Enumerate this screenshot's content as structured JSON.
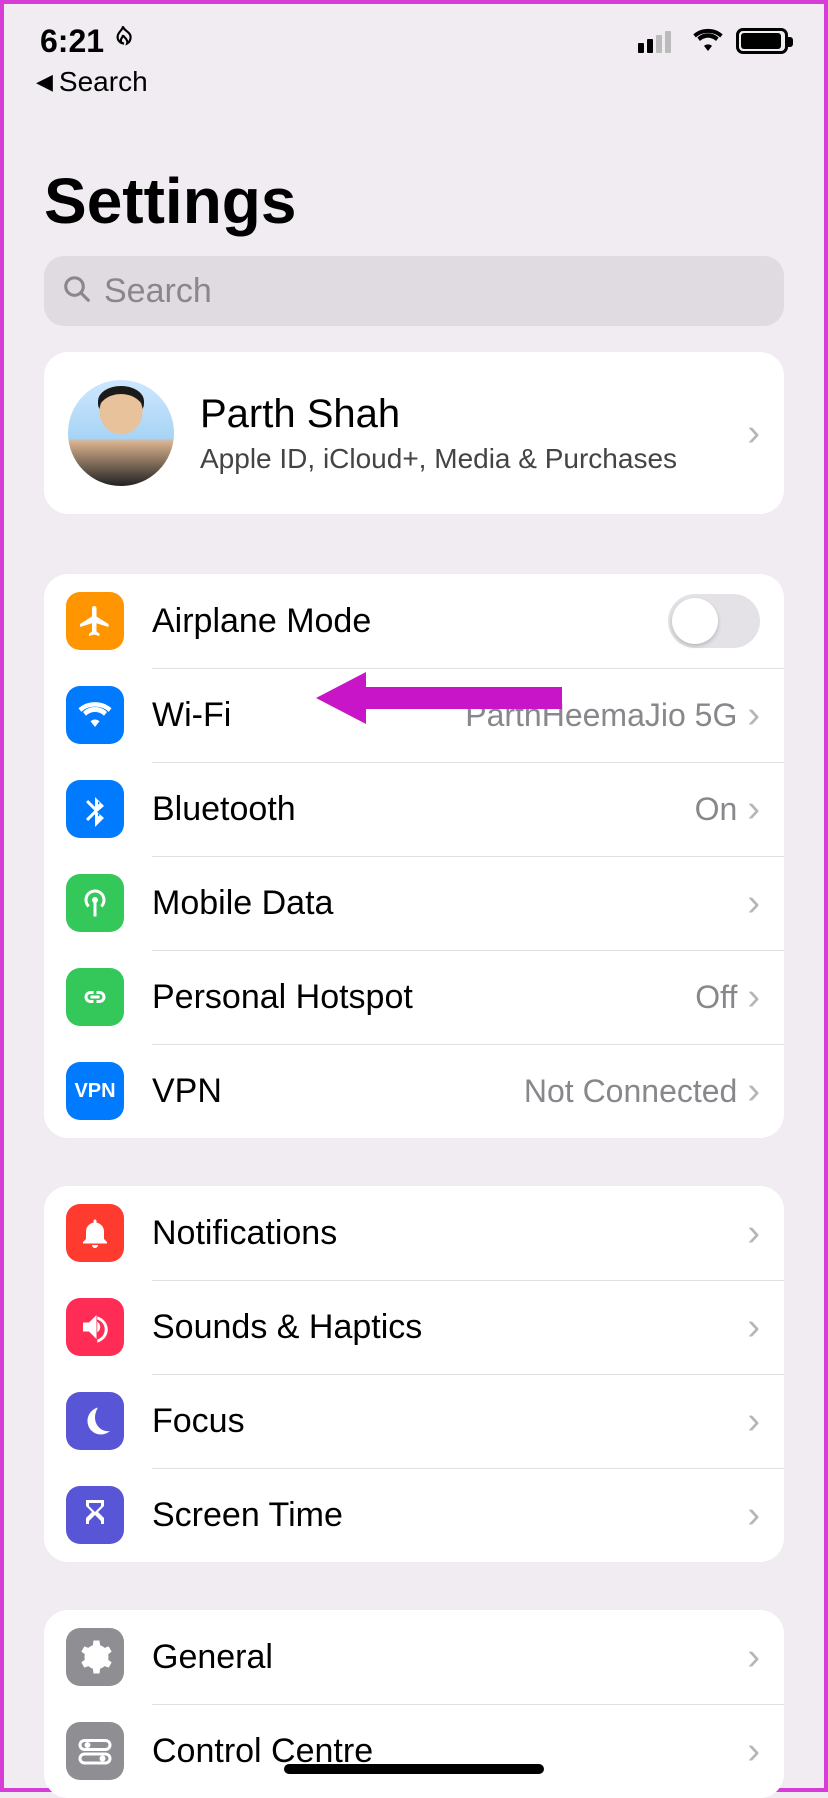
{
  "status": {
    "time": "6:21"
  },
  "back": {
    "label": "Search"
  },
  "title": "Settings",
  "search": {
    "placeholder": "Search"
  },
  "profile": {
    "name": "Parth Shah",
    "subtitle": "Apple ID, iCloud+, Media & Purchases"
  },
  "network": {
    "airplane": "Airplane Mode",
    "wifi": {
      "label": "Wi-Fi",
      "value": "ParthHeemaJio 5G"
    },
    "bluetooth": {
      "label": "Bluetooth",
      "value": "On"
    },
    "mobile": "Mobile Data",
    "hotspot": {
      "label": "Personal Hotspot",
      "value": "Off"
    },
    "vpn": {
      "label": "VPN",
      "value": "Not Connected"
    }
  },
  "prefs": {
    "notifications": "Notifications",
    "sounds": "Sounds & Haptics",
    "focus": "Focus",
    "screentime": "Screen Time"
  },
  "system": {
    "general": "General",
    "control": "Control Centre"
  }
}
